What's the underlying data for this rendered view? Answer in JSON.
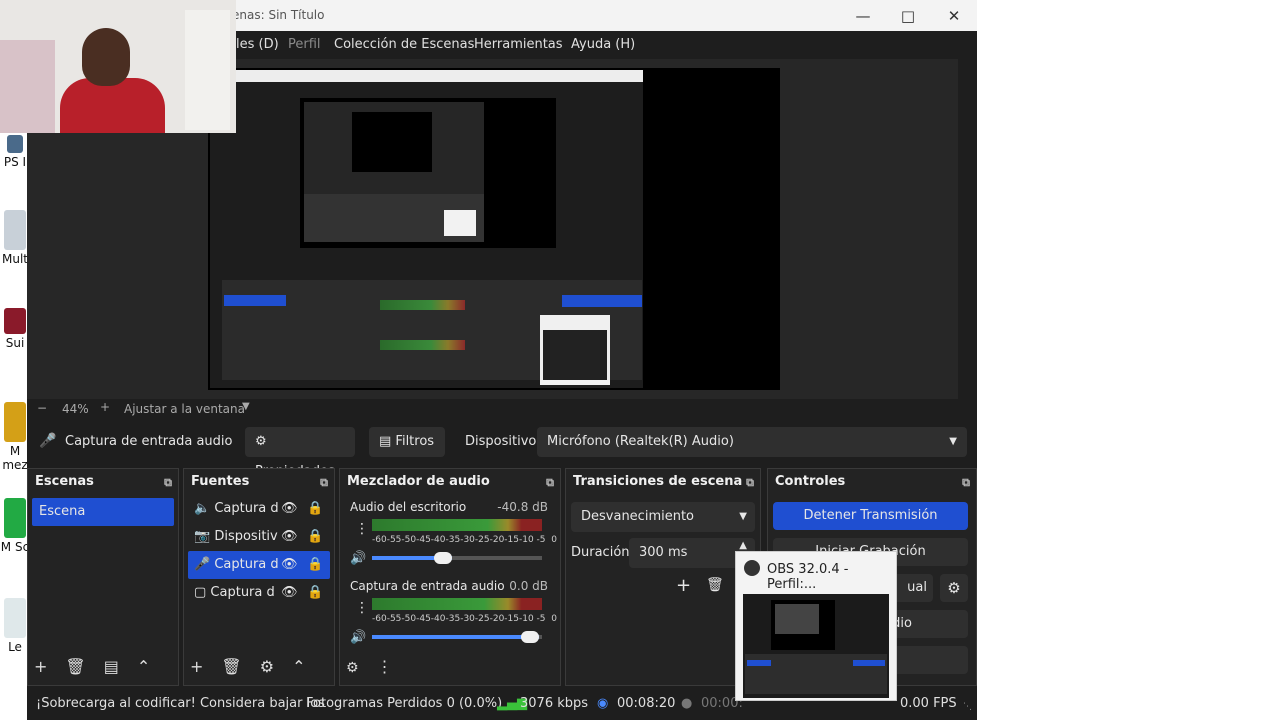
{
  "window": {
    "title": "enas: Sin Título"
  },
  "menu": {
    "items": [
      "les (D)",
      "Perfil",
      "Colección de Escenas",
      "Herramientas",
      "Ayuda (H)"
    ]
  },
  "preview": {
    "zoom": "44%",
    "fit_label": "Ajustar a la ventana"
  },
  "source_bar": {
    "source_name": "Captura de entrada audio",
    "properties": "Propiedades",
    "filters": "Filtros",
    "device_label": "Dispositivo",
    "device_value": "Micrófono (Realtek(R) Audio)"
  },
  "docks": {
    "scenes": {
      "title": "Escenas",
      "items": [
        "Escena"
      ]
    },
    "sources": {
      "title": "Fuentes",
      "items": [
        "Captura d",
        "Dispositiv",
        "Captura d",
        "Captura d"
      ]
    },
    "mixer": {
      "title": "Mezclador de audio",
      "channels": [
        {
          "name": "Audio del escritorio",
          "db": "-40.8 dB",
          "volume": 0.47
        },
        {
          "name": "Captura de entrada audio",
          "db": "0.0 dB",
          "volume": 0.98
        }
      ],
      "scale": "-60-55-50-45-40-35-30-25-20-15-10 -5  0"
    },
    "transitions": {
      "title": "Transiciones de escena",
      "transition": "Desvanecimiento",
      "duration_label": "Duración",
      "duration_value": "300 ms"
    },
    "controls": {
      "title": "Controles",
      "buttons": [
        "Detener Transmisión",
        "Iniciar Grabación",
        "ual",
        "dio",
        ""
      ]
    }
  },
  "status": {
    "warning": "¡Sobrecarga al codificar! Considera bajar los",
    "dropped": "Fotogramas Perdidos 0 (0.0%)",
    "bitrate": "3076 kbps",
    "stream_time": "00:08:20",
    "rec_time": "00:00:",
    "fps": "0.00 FPS"
  },
  "popup": {
    "title": "OBS 32.0.4 - Perfil:..."
  },
  "desktop": {
    "labels": [
      "PS I",
      "Mult",
      "Sui",
      "M mez",
      "M Sc",
      "Le"
    ]
  },
  "colors": {
    "accent": "#1f4fd1",
    "bg": "#1e1e1e"
  }
}
